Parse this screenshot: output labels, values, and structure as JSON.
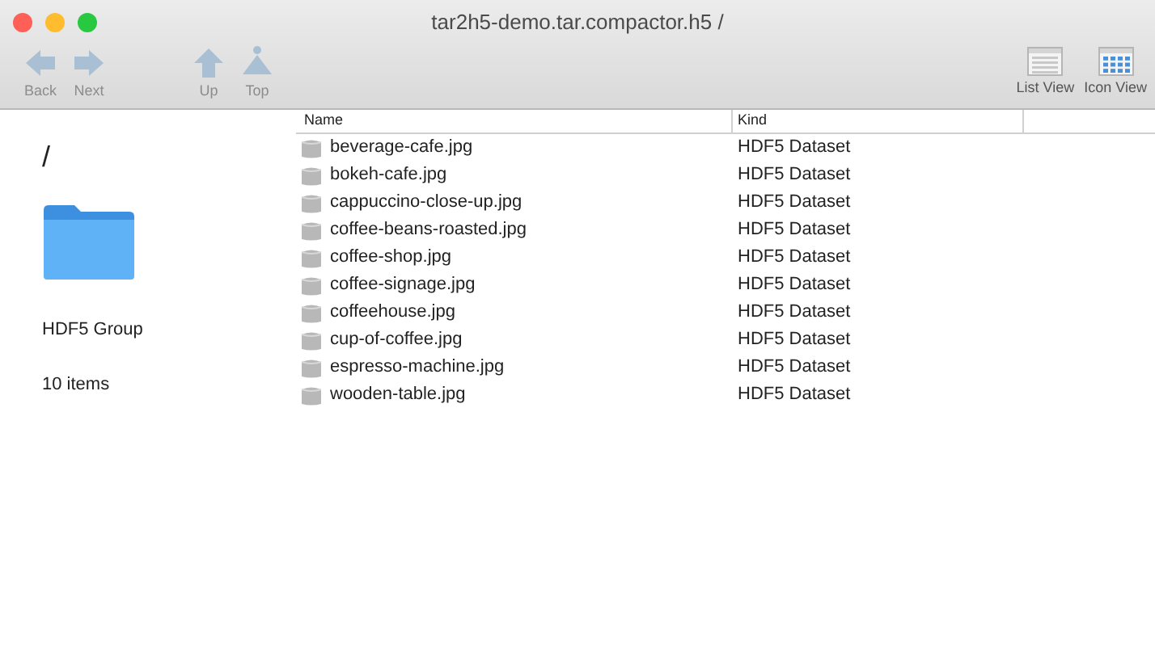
{
  "window": {
    "title": "tar2h5-demo.tar.compactor.h5 /"
  },
  "toolbar": {
    "nav": [
      {
        "label": "Back",
        "kind": "back"
      },
      {
        "label": "Next",
        "kind": "next"
      },
      {
        "label": "Up",
        "kind": "up"
      },
      {
        "label": "Top",
        "kind": "top"
      }
    ],
    "views": [
      {
        "label": "List View",
        "kind": "list"
      },
      {
        "label": "Icon View",
        "kind": "icon"
      }
    ]
  },
  "info": {
    "path": "/",
    "kind": "HDF5 Group",
    "count": "10 items"
  },
  "table": {
    "columns": [
      "Name",
      "Kind"
    ],
    "rows": [
      {
        "name": "beverage-cafe.jpg",
        "kind": "HDF5 Dataset"
      },
      {
        "name": "bokeh-cafe.jpg",
        "kind": "HDF5 Dataset"
      },
      {
        "name": "cappuccino-close-up.jpg",
        "kind": "HDF5 Dataset"
      },
      {
        "name": "coffee-beans-roasted.jpg",
        "kind": "HDF5 Dataset"
      },
      {
        "name": "coffee-shop.jpg",
        "kind": "HDF5 Dataset"
      },
      {
        "name": "coffee-signage.jpg",
        "kind": "HDF5 Dataset"
      },
      {
        "name": "coffeehouse.jpg",
        "kind": "HDF5 Dataset"
      },
      {
        "name": "cup-of-coffee.jpg",
        "kind": "HDF5 Dataset"
      },
      {
        "name": "espresso-machine.jpg",
        "kind": "HDF5 Dataset"
      },
      {
        "name": "wooden-table.jpg",
        "kind": "HDF5 Dataset"
      }
    ]
  }
}
